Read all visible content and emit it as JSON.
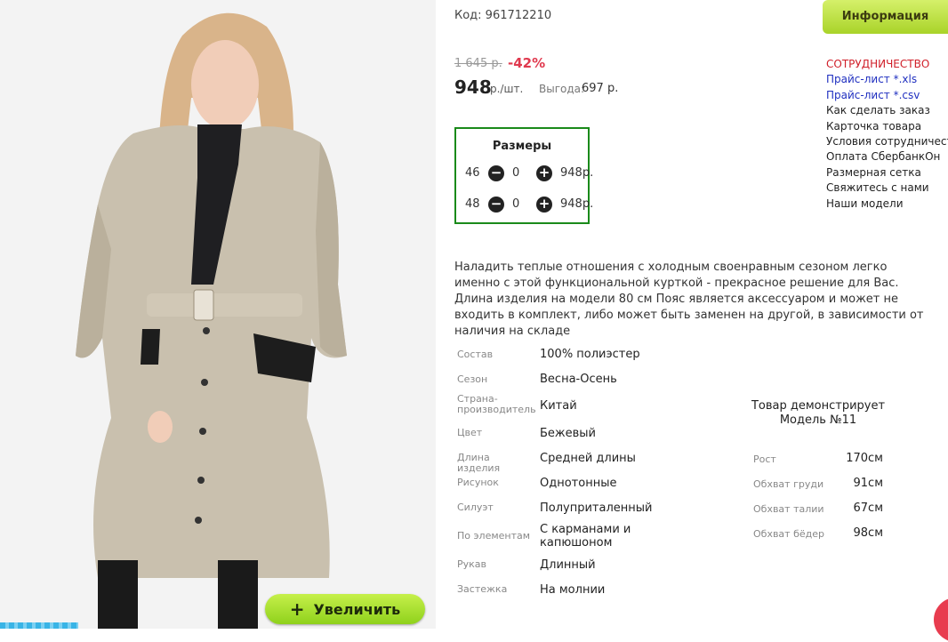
{
  "product": {
    "code_label": "Код: 961712210",
    "old_price": "1 645 р.",
    "discount": "-42%",
    "price": "948",
    "price_unit": "р./шт.",
    "benefit_label": "Выгода:",
    "benefit_value": "697 р."
  },
  "sizes": {
    "title": "Размеры",
    "rows": [
      {
        "size": "46",
        "qty": "0",
        "price": "948р."
      },
      {
        "size": "48",
        "qty": "0",
        "price": "948р."
      }
    ]
  },
  "description": "Наладить теплые отношения с холодным своенравным сезоном легко именно с этой функциональной курткой - прекрасное решение для Вас. Длина изделия на модели 80 см Пояс является аксессуаром и может не входить в комплект, либо может быть заменен на другой, в зависимости от наличия на складе",
  "specs": [
    {
      "label": "Состав",
      "value": "100% полиэстер"
    },
    {
      "label": "Сезон",
      "value": "Весна-Осень"
    },
    {
      "label": "Страна-производитель",
      "value": "Китай"
    },
    {
      "label": "Цвет",
      "value": "Бежевый"
    },
    {
      "label": "Длина изделия",
      "value": "Средней длины"
    },
    {
      "label": "Рисунок",
      "value": "Однотонные"
    },
    {
      "label": "Силуэт",
      "value": "Полуприталенный"
    },
    {
      "label": "По элементам",
      "value": "С карманами и капюшоном"
    },
    {
      "label": "Рукав",
      "value": "Длинный"
    },
    {
      "label": "Застежка",
      "value": "На молнии"
    }
  ],
  "model": {
    "title": "Товар демонстрирует Модель №11",
    "measurements": [
      {
        "label": "Рост",
        "value": "170см"
      },
      {
        "label": "Обхват груди",
        "value": "91см"
      },
      {
        "label": "Обхват талии",
        "value": "67см"
      },
      {
        "label": "Обхват бёдер",
        "value": "98см"
      }
    ]
  },
  "sidebar": {
    "tab_label": "Информация",
    "cooperation": "СОТРУДНИЧЕСТВО",
    "pricelist_xls": "Прайс-лист *.xls",
    "pricelist_csv": "Прайс-лист *.csv",
    "links": [
      "Как сделать заказ",
      "Карточка товара",
      "Условия сотрудничества",
      "Оплата СбербанкОн",
      "Размерная сетка",
      "Свяжитесь с нами",
      "Наши модели"
    ]
  },
  "photo": {
    "zoom_label": "Увеличить",
    "zoom_icon": "plus-icon"
  },
  "colors": {
    "accent_green": "#9fd32a",
    "price_red": "#e0394e",
    "link_blue": "#2030c0",
    "coop_red": "#d0202a",
    "sizes_border": "#1a8a1a"
  }
}
